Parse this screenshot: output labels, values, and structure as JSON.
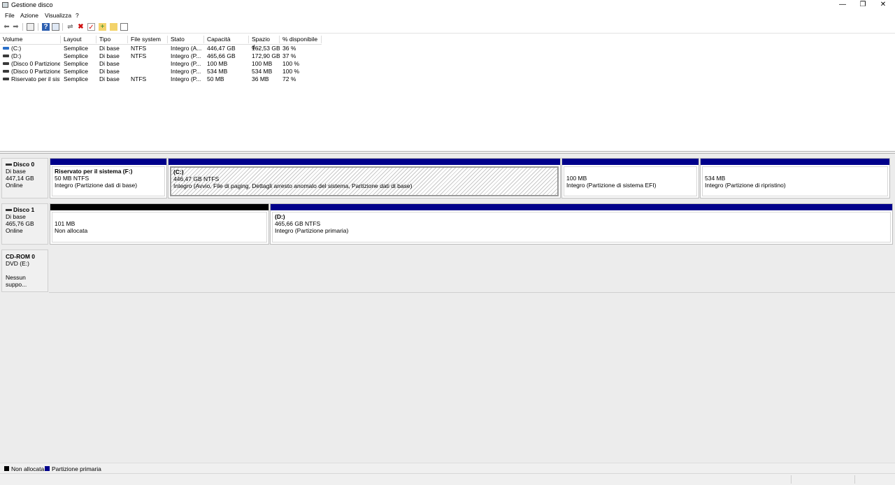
{
  "window": {
    "title": "Gestione disco",
    "min": "—",
    "max": "❐",
    "close": "✕"
  },
  "menu": [
    "File",
    "Azione",
    "Visualizza",
    "?"
  ],
  "toolbar": [
    "back-icon",
    "forward-icon",
    "properties-icon",
    "help-icon",
    "console-icon",
    "connect-icon",
    "delete-icon",
    "check-icon",
    "folder-new-icon",
    "folder-open-icon",
    "view-icon"
  ],
  "columns": [
    "Volume",
    "Layout",
    "Tipo",
    "File system",
    "Stato",
    "Capacità",
    "Spazio d...",
    "% disponibile"
  ],
  "volumes": [
    {
      "icon": "blue",
      "volume": "(C:)",
      "layout": "Semplice",
      "tipo": "Di base",
      "fs": "NTFS",
      "stato": "Integro (A...",
      "capacita": "446,47 GB",
      "spazio": "162,53 GB",
      "perc": "36 %"
    },
    {
      "icon": "dark",
      "volume": "(D:)",
      "layout": "Semplice",
      "tipo": "Di base",
      "fs": "NTFS",
      "stato": "Integro (P...",
      "capacita": "465,66 GB",
      "spazio": "172,90 GB",
      "perc": "37 %"
    },
    {
      "icon": "dark",
      "volume": "(Disco 0 Partizione...",
      "layout": "Semplice",
      "tipo": "Di base",
      "fs": "",
      "stato": "Integro (P...",
      "capacita": "100 MB",
      "spazio": "100 MB",
      "perc": "100 %"
    },
    {
      "icon": "dark",
      "volume": "(Disco 0 Partizione...",
      "layout": "Semplice",
      "tipo": "Di base",
      "fs": "",
      "stato": "Integro (P...",
      "capacita": "534 MB",
      "spazio": "534 MB",
      "perc": "100 %"
    },
    {
      "icon": "dark",
      "volume": "Riservato per il sist...",
      "layout": "Semplice",
      "tipo": "Di base",
      "fs": "NTFS",
      "stato": "Integro (P...",
      "capacita": "50 MB",
      "spazio": "36 MB",
      "perc": "72 %"
    }
  ],
  "disks": {
    "disk0": {
      "name": "Disco 0",
      "type": "Di base",
      "size": "447,14 GB",
      "status": "Online",
      "partitions": {
        "p1": {
          "name": "Riservato per il sistema  (F:)",
          "size": "50 MB NTFS",
          "status": "Integro (Partizione dati di base)"
        },
        "p2": {
          "name": "(C:)",
          "size": "446,47 GB NTFS",
          "status": "Integro (Avvio, File di paging, Dettagli arresto anomalo del sistema, Partizione dati di base)"
        },
        "p3": {
          "size": "100 MB",
          "status": "Integro (Partizione di sistema EFI)"
        },
        "p4": {
          "size": "534 MB",
          "status": "Integro (Partizione di ripristino)"
        }
      }
    },
    "disk1": {
      "name": "Disco 1",
      "type": "Di base",
      "size": "465,76 GB",
      "status": "Online",
      "partitions": {
        "p1": {
          "size": "101 MB",
          "status": "Non allocata"
        },
        "p2": {
          "name": "(D:)",
          "size": "465,66 GB NTFS",
          "status": "Integro (Partizione primaria)"
        }
      }
    },
    "cdrom0": {
      "name": "CD-ROM 0",
      "type": "DVD (E:)",
      "status": "Nessun suppo..."
    }
  },
  "legend": {
    "unallocated": {
      "label": "Non allocata",
      "color": "#000000"
    },
    "primary": {
      "label": "Partizione primaria",
      "color": "#00008b"
    }
  }
}
